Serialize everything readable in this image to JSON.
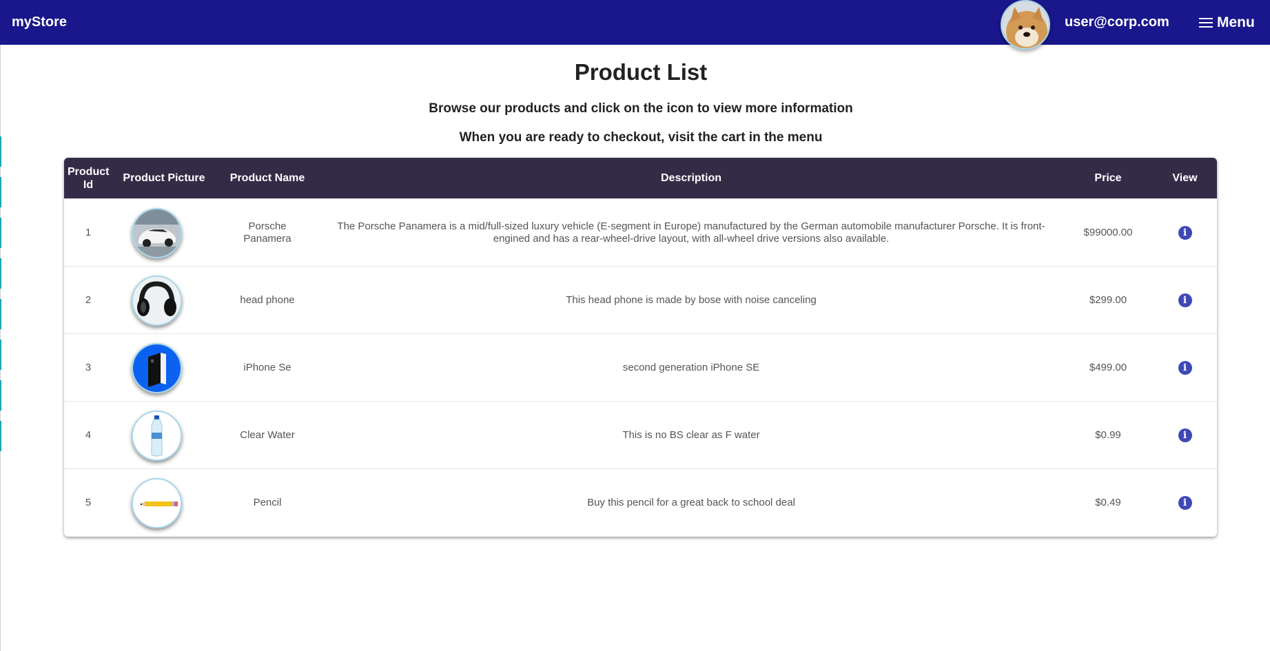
{
  "navbar": {
    "brand": "myStore",
    "user_email": "user@corp.com",
    "menu_label": "Menu"
  },
  "page": {
    "title": "Product List",
    "subtitle_1": "Browse our products and click on the icon to view more information",
    "subtitle_2": "When you are ready to checkout, visit the cart in the menu"
  },
  "table": {
    "headers": {
      "id": "Product Id",
      "picture": "Product Picture",
      "name": "Product Name",
      "description": "Description",
      "price": "Price",
      "view": "View"
    },
    "rows": [
      {
        "id": "1",
        "name": "Porsche Panamera",
        "description": "The Porsche Panamera is a mid/full-sized luxury vehicle (E-segment in Europe) manufactured by the German automobile manufacturer Porsche. It is front-engined and has a rear-wheel-drive layout, with all-wheel drive versions also available.",
        "price": "$99000.00",
        "image": "car-photo"
      },
      {
        "id": "2",
        "name": "head phone",
        "description": "This head phone is made by bose with noise canceling",
        "price": "$299.00",
        "image": "headphones-photo"
      },
      {
        "id": "3",
        "name": "iPhone Se",
        "description": "second generation iPhone SE",
        "price": "$499.00",
        "image": "phone-photo"
      },
      {
        "id": "4",
        "name": "Clear Water",
        "description": "This is no BS clear as F water",
        "price": "$0.99",
        "image": "water-bottle-photo"
      },
      {
        "id": "5",
        "name": "Pencil",
        "description": "Buy this pencil for a great back to school deal",
        "price": "$0.49",
        "image": "pencil-photo"
      }
    ]
  },
  "icons": {
    "menu": "menu-icon",
    "info": "info-icon"
  },
  "colors": {
    "navbar_bg": "#19178b",
    "table_header_bg": "#342c47",
    "info_icon": "#3f49b5",
    "avatar_ring": "#a8d6ea"
  }
}
